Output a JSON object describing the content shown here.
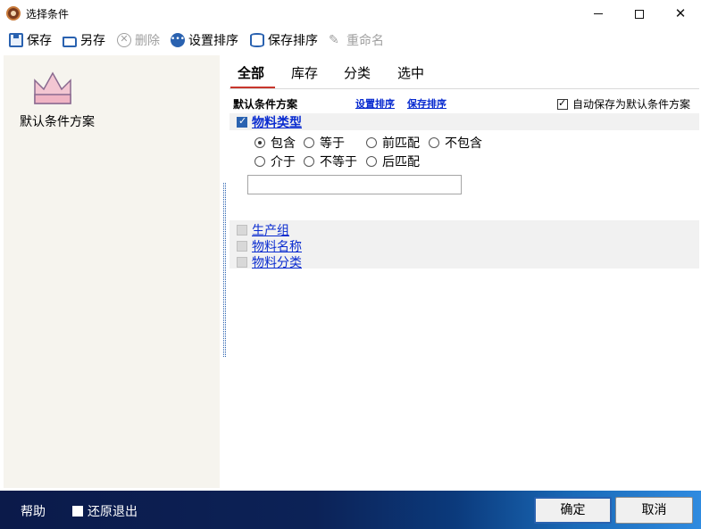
{
  "window": {
    "title": "选择条件"
  },
  "toolbar": {
    "save": "保存",
    "save_as": "另存",
    "delete": "删除",
    "set_sort": "设置排序",
    "save_sort": "保存排序",
    "rename": "重命名"
  },
  "left_panel": {
    "scheme_label": "默认条件方案"
  },
  "tabs": [
    {
      "label": "全部",
      "active": true
    },
    {
      "label": "库存",
      "active": false
    },
    {
      "label": "分类",
      "active": false
    },
    {
      "label": "选中",
      "active": false
    }
  ],
  "scheme": {
    "name": "默认条件方案",
    "set_sort_link": "设置排序",
    "save_sort_link": "保存排序",
    "autosave_label": "自动保存为默认条件方案",
    "autosave_checked": true
  },
  "condition": {
    "title": "物料类型",
    "checked": true,
    "options_row1": [
      "包含",
      "等于",
      "前匹配",
      "不包含"
    ],
    "options_row2": [
      "介于",
      "不等于",
      "后匹配"
    ],
    "selected": "包含",
    "value": ""
  },
  "other_conditions": [
    {
      "label": "生产组",
      "checked": false
    },
    {
      "label": "物料名称",
      "checked": false
    },
    {
      "label": "物料分类",
      "checked": false
    }
  ],
  "bottom": {
    "help": "帮助",
    "restore_exit": "还原退出",
    "ok": "确定",
    "cancel": "取消"
  },
  "colors": {
    "link": "#0a2cd0",
    "accent": "#2a62b0",
    "tab_underline": "#c8362c"
  }
}
